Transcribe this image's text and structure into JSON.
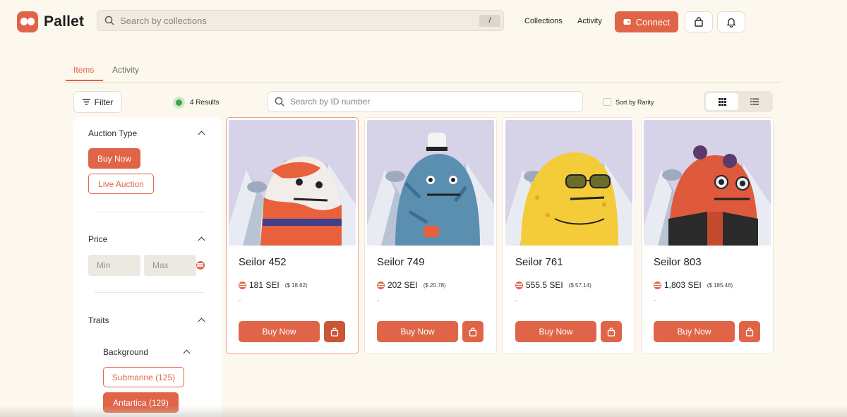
{
  "app": {
    "name": "Pallet"
  },
  "header": {
    "search_placeholder": "Search by collections",
    "search_shortcut": "/",
    "nav": {
      "collections": "Collections",
      "activity": "Activity"
    },
    "connect_label": "Connect",
    "icons": [
      "bag-icon",
      "bell-icon"
    ]
  },
  "tabs": {
    "items": "Items",
    "activity": "Activity",
    "active": "items"
  },
  "toolbar": {
    "filter_label": "Filter",
    "results_label": "4 Results",
    "id_search_placeholder": "Search by ID number",
    "sort_rarity_label": "Sort by Rarity",
    "sort_rarity_checked": false,
    "view_mode": "grid"
  },
  "sidebar": {
    "auction": {
      "title": "Auction Type",
      "buy_now": "Buy Now",
      "live_auction": "Live Auction",
      "selected": "Buy Now"
    },
    "price": {
      "title": "Price",
      "min_placeholder": "Min",
      "max_placeholder": "Max"
    },
    "traits": {
      "title": "Traits",
      "background": {
        "title": "Background",
        "options": [
          {
            "label": "Submarine (125)",
            "selected": false
          },
          {
            "label": "Antartica (129)",
            "selected": true
          }
        ]
      }
    }
  },
  "cards": [
    {
      "title": "Seilor 452",
      "price": "181 SEI",
      "usd": "($ 18.62)",
      "last": "-",
      "buy_label": "Buy Now",
      "body_color": "#f2ede8",
      "accent": "#e8603c"
    },
    {
      "title": "Seilor 749",
      "price": "202 SEI",
      "usd": "($ 20.78)",
      "last": "-",
      "buy_label": "Buy Now",
      "body_color": "#5b8fb0",
      "accent": "#3f6f90"
    },
    {
      "title": "Seilor 761",
      "price": "555.5 SEI",
      "usd": "($ 57.14)",
      "last": "-",
      "buy_label": "Buy Now",
      "body_color": "#f4cc3a",
      "accent": "#d9a92a"
    },
    {
      "title": "Seilor 803",
      "price": "1,803 SEI",
      "usd": "($ 185.46)",
      "last": "-",
      "buy_label": "Buy Now",
      "body_color": "#df5a3c",
      "accent": "#b8402a"
    }
  ],
  "colors": {
    "brand": "#e06548",
    "page_bg": "#fdf8ee",
    "card_bg": "#ffffff",
    "status_green": "#3aa84a"
  }
}
